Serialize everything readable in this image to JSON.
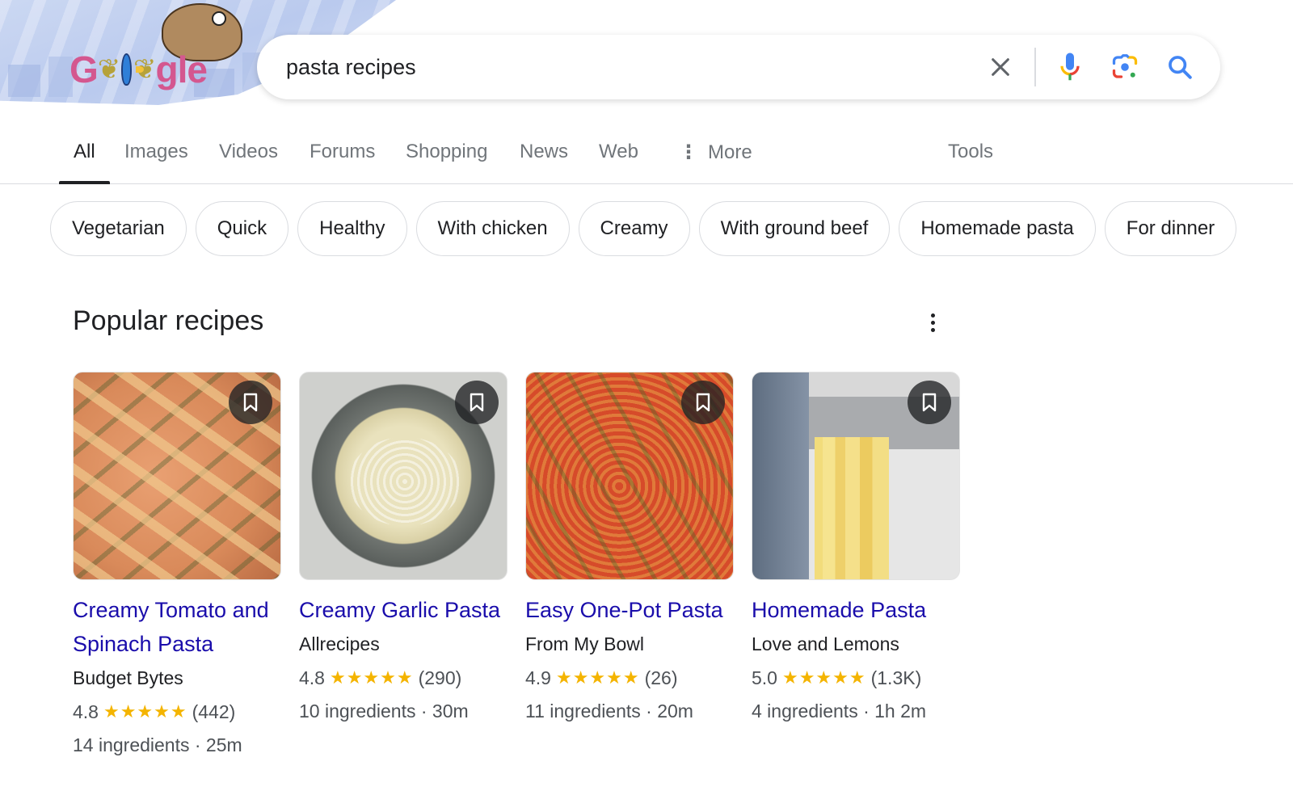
{
  "header": {
    "logo_text": "Google",
    "doodle": "google-doodle"
  },
  "search": {
    "query": "pasta recipes",
    "clear_label": "Clear",
    "voice_label": "Search by voice",
    "lens_label": "Search by image",
    "search_label": "Search"
  },
  "tabs": [
    {
      "label": "All",
      "active": true
    },
    {
      "label": "Images"
    },
    {
      "label": "Videos"
    },
    {
      "label": "Forums"
    },
    {
      "label": "Shopping"
    },
    {
      "label": "News"
    },
    {
      "label": "Web"
    },
    {
      "label": "More"
    },
    {
      "label": "Tools"
    }
  ],
  "chips": [
    "Vegetarian",
    "Quick",
    "Healthy",
    "With chicken",
    "Creamy",
    "With ground beef",
    "Homemade pasta",
    "For dinner"
  ],
  "section": {
    "title": "Popular recipes"
  },
  "recipes": [
    {
      "title": "Creamy Tomato and Spinach Pasta",
      "source": "Budget Bytes",
      "rating": "4.8",
      "stars": "★★★★★",
      "reviews": "(442)",
      "meta": "14 ingredients · 25m"
    },
    {
      "title": "Creamy Garlic Pasta",
      "source": "Allrecipes",
      "rating": "4.8",
      "stars": "★★★★★",
      "reviews": "(290)",
      "meta": "10 ingredients · 30m"
    },
    {
      "title": "Easy One-Pot Pasta",
      "source": "From My Bowl",
      "rating": "4.9",
      "stars": "★★★★★",
      "reviews": "(26)",
      "meta": "11 ingredients · 20m"
    },
    {
      "title": "Homemade Pasta",
      "source": "Love and Lemons",
      "rating": "5.0",
      "stars": "★★★★★",
      "reviews": "(1.3K)",
      "meta": "4 ingredients · 1h 2m"
    }
  ],
  "colors": {
    "link": "#1a0dab",
    "star": "#f4b400",
    "search_blue": "#4285f4"
  }
}
